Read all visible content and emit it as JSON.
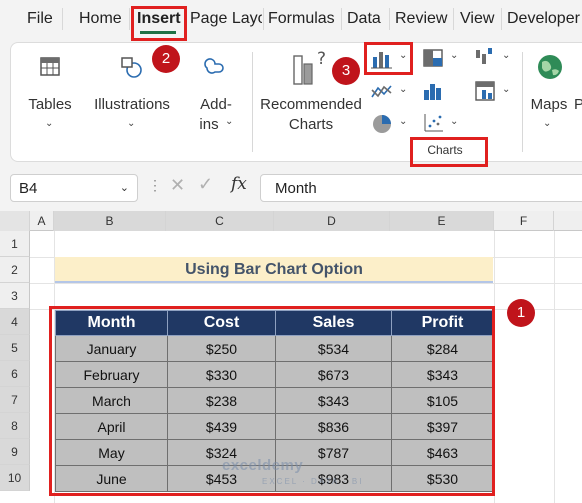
{
  "menu": {
    "tabs": [
      "File",
      "Home",
      "Insert",
      "Page Layout",
      "Formulas",
      "Data",
      "Review",
      "View",
      "Developer"
    ],
    "active": "Insert"
  },
  "ribbon": {
    "tables_label": "Tables",
    "illustrations_label": "Illustrations",
    "addins_label_line1": "Add-",
    "addins_label_line2": "ins",
    "recommended_line1": "Recommended",
    "recommended_line2": "Charts",
    "maps_label": "Maps",
    "charts_group_label": "Charts",
    "pivot_initial": "P"
  },
  "formula_bar": {
    "name_box": "B4",
    "fx_symbol": "fx",
    "content": "Month"
  },
  "grid": {
    "columns": [
      "A",
      "B",
      "C",
      "D",
      "E",
      "F"
    ],
    "rows": [
      "1",
      "2",
      "3",
      "4",
      "5",
      "6",
      "7",
      "8",
      "9",
      "10"
    ],
    "title": "Using Bar Chart Option"
  },
  "table": {
    "headers": [
      "Month",
      "Cost",
      "Sales",
      "Profit"
    ],
    "rows": [
      [
        "January",
        "$250",
        "$534",
        "$284"
      ],
      [
        "February",
        "$330",
        "$673",
        "$343"
      ],
      [
        "March",
        "$238",
        "$343",
        "$105"
      ],
      [
        "April",
        "$439",
        "$836",
        "$397"
      ],
      [
        "May",
        "$324",
        "$787",
        "$463"
      ],
      [
        "June",
        "$453",
        "$983",
        "$530"
      ]
    ]
  },
  "annotations": {
    "step1": "1",
    "step2": "2",
    "step3": "3"
  },
  "watermark": {
    "brand": "exceldemy",
    "tagline": "EXCEL · DATA · BI"
  },
  "colors": {
    "accent_green": "#1e7145",
    "header_navy": "#203864",
    "title_fill": "#fcefc9",
    "annotation_red": "#e0201f",
    "badge_red": "#c0141b",
    "cell_gray": "#bfbfbf"
  }
}
